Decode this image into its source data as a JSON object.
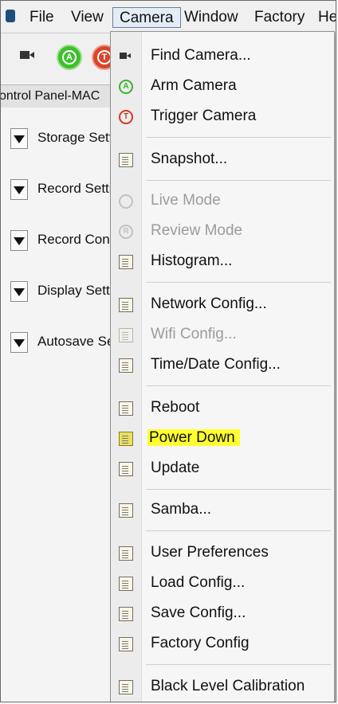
{
  "menubar": {
    "items": [
      {
        "label": "File"
      },
      {
        "label": "View"
      },
      {
        "label": "Camera"
      },
      {
        "label": "Window"
      },
      {
        "label": "Factory"
      },
      {
        "label": "He"
      }
    ]
  },
  "toolbar": {
    "arm_letter": "A",
    "trigger_letter": "T"
  },
  "panel": {
    "tab_title": "ontrol Panel-MAC",
    "sections": [
      {
        "label": "Storage Sett"
      },
      {
        "label": "Record Settir"
      },
      {
        "label": "Record Contr"
      },
      {
        "label": "Display Settir"
      },
      {
        "label": "Autosave Se"
      }
    ]
  },
  "camera_menu": {
    "items": [
      {
        "label": "Find Camera...",
        "icon": "camera-icon",
        "enabled": true
      },
      {
        "label": "Arm Camera",
        "icon": "arm-icon",
        "enabled": true
      },
      {
        "label": "Trigger Camera",
        "icon": "trigger-icon",
        "enabled": true
      },
      {
        "label": "Snapshot...",
        "icon": "document-icon",
        "enabled": true
      },
      {
        "label": "Live Mode",
        "icon": "live-mode-icon",
        "enabled": false
      },
      {
        "label": "Review Mode",
        "icon": "review-mode-icon",
        "enabled": false
      },
      {
        "label": "Histogram...",
        "icon": "document-icon",
        "enabled": true
      },
      {
        "label": "Network Config...",
        "icon": "document-icon",
        "enabled": true
      },
      {
        "label": "Wifi Config...",
        "icon": "document-icon",
        "enabled": false
      },
      {
        "label": "Time/Date Config...",
        "icon": "document-icon",
        "enabled": true
      },
      {
        "label": "Reboot",
        "icon": "document-icon",
        "enabled": true
      },
      {
        "label": "Power Down",
        "icon": "document-icon",
        "enabled": true,
        "highlighted": true
      },
      {
        "label": "Update",
        "icon": "document-icon",
        "enabled": true
      },
      {
        "label": "Samba...",
        "icon": "document-icon",
        "enabled": true
      },
      {
        "label": "User Preferences",
        "icon": "document-icon",
        "enabled": true
      },
      {
        "label": "Load Config...",
        "icon": "document-icon",
        "enabled": true
      },
      {
        "label": "Save Config...",
        "icon": "document-icon",
        "enabled": true
      },
      {
        "label": "Factory Config",
        "icon": "document-icon",
        "enabled": true
      },
      {
        "label": "Black Level Calibration",
        "icon": "document-icon",
        "enabled": true
      }
    ],
    "icon_letters": {
      "arm": "A",
      "trigger": "T",
      "review": "R"
    }
  },
  "colors": {
    "highlight": "#ffff33",
    "arm_green": "#39b52a",
    "trigger_red": "#cf3b22"
  }
}
